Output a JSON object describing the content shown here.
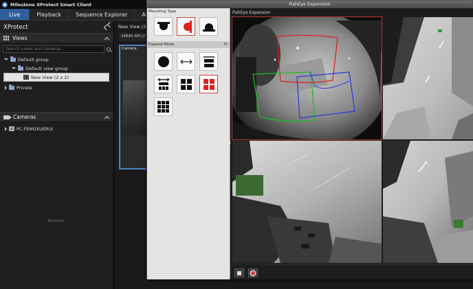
{
  "app": {
    "title": "Milestone XProtect Smart Client"
  },
  "main_tabs": [
    {
      "label": "Live",
      "active": true
    },
    {
      "label": "Playback",
      "active": false
    },
    {
      "label": "Sequence Explorer",
      "active": false
    },
    {
      "label": "Al",
      "active": false
    }
  ],
  "left_panel": {
    "title": "XProtect",
    "views": {
      "header": "Views",
      "search_placeholder": "Search views and cameras...",
      "tree": {
        "group": "Default group",
        "subgroup": "Default view group",
        "selected_view": "New View (2 x 2)",
        "private": "Private"
      }
    },
    "cameras": {
      "header": "Cameras",
      "server": "PC-FENGXUERUI"
    }
  },
  "view_area": {
    "tab_label": "New View (2",
    "toolbar_text": "34840 AM (2",
    "tile_label": "Camera"
  },
  "dialog": {
    "title": "FishEye Expansion",
    "mounting_label": "Mounting Type",
    "expand_label": "Expand Mode",
    "expansion_label": "FishEye Expansion",
    "mounting_icons": [
      "ceiling-mount-icon",
      "wall-mount-icon",
      "floor-mount-icon"
    ],
    "expand_icons": [
      "original-fisheye-icon",
      "panorama-icon",
      "double-panorama-icon",
      "panorama-plus-icon",
      "quad-view-icon",
      "quad-view-active-icon",
      "nine-view-icon"
    ],
    "active_mounting": "wall",
    "active_expand": "quad",
    "accent_color": "#d22222"
  }
}
